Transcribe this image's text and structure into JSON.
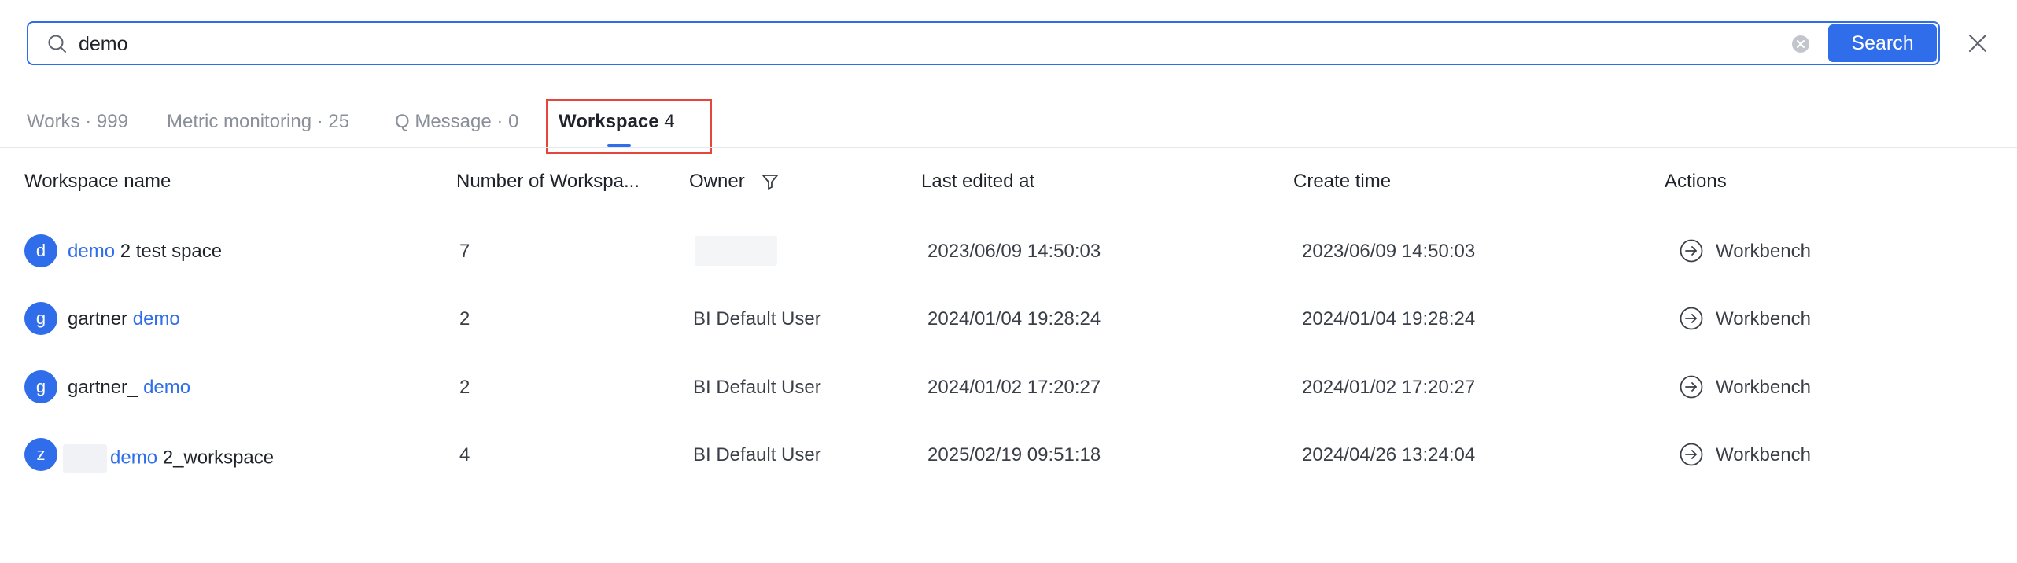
{
  "search": {
    "value": "demo",
    "button_label": "Search"
  },
  "tabs": [
    {
      "label": "Works · 999"
    },
    {
      "label": "Metric monitoring · 25"
    },
    {
      "label": "Q Message · 0"
    },
    {
      "label": "Workspace",
      "count": "4",
      "active": true
    }
  ],
  "table": {
    "columns": [
      "Workspace name",
      "Number of Workspa...",
      "Owner",
      "Last edited at",
      "Create time",
      "Actions"
    ],
    "rows": [
      {
        "avatar": "d",
        "name_pre": "",
        "name_hl": "demo",
        "name_post": " 2 test space",
        "members": "7",
        "owner": "",
        "last_edited": "2023/06/09 14:50:03",
        "created": "2023/06/09 14:50:03",
        "action": "Workbench"
      },
      {
        "avatar": "g",
        "name_pre": "gartner ",
        "name_hl": "demo",
        "name_post": "",
        "members": "2",
        "owner": "BI Default User",
        "last_edited": "2024/01/04 19:28:24",
        "created": "2024/01/04 19:28:24",
        "action": "Workbench"
      },
      {
        "avatar": "g",
        "name_pre": "gartner_ ",
        "name_hl": "demo",
        "name_post": "",
        "members": "2",
        "owner": "BI Default User",
        "last_edited": "2024/01/02 17:20:27",
        "created": "2024/01/02 17:20:27",
        "action": "Workbench"
      },
      {
        "avatar": "z",
        "name_pre": "",
        "name_hl": "demo",
        "name_post": " 2_workspace",
        "members": "4",
        "owner": "BI Default User",
        "last_edited": "2025/02/19 09:51:18",
        "created": "2024/04/26 13:24:04",
        "action": "Workbench"
      }
    ]
  },
  "colors": {
    "accent": "#2f6dea",
    "highlight_box": "#e5463b"
  }
}
